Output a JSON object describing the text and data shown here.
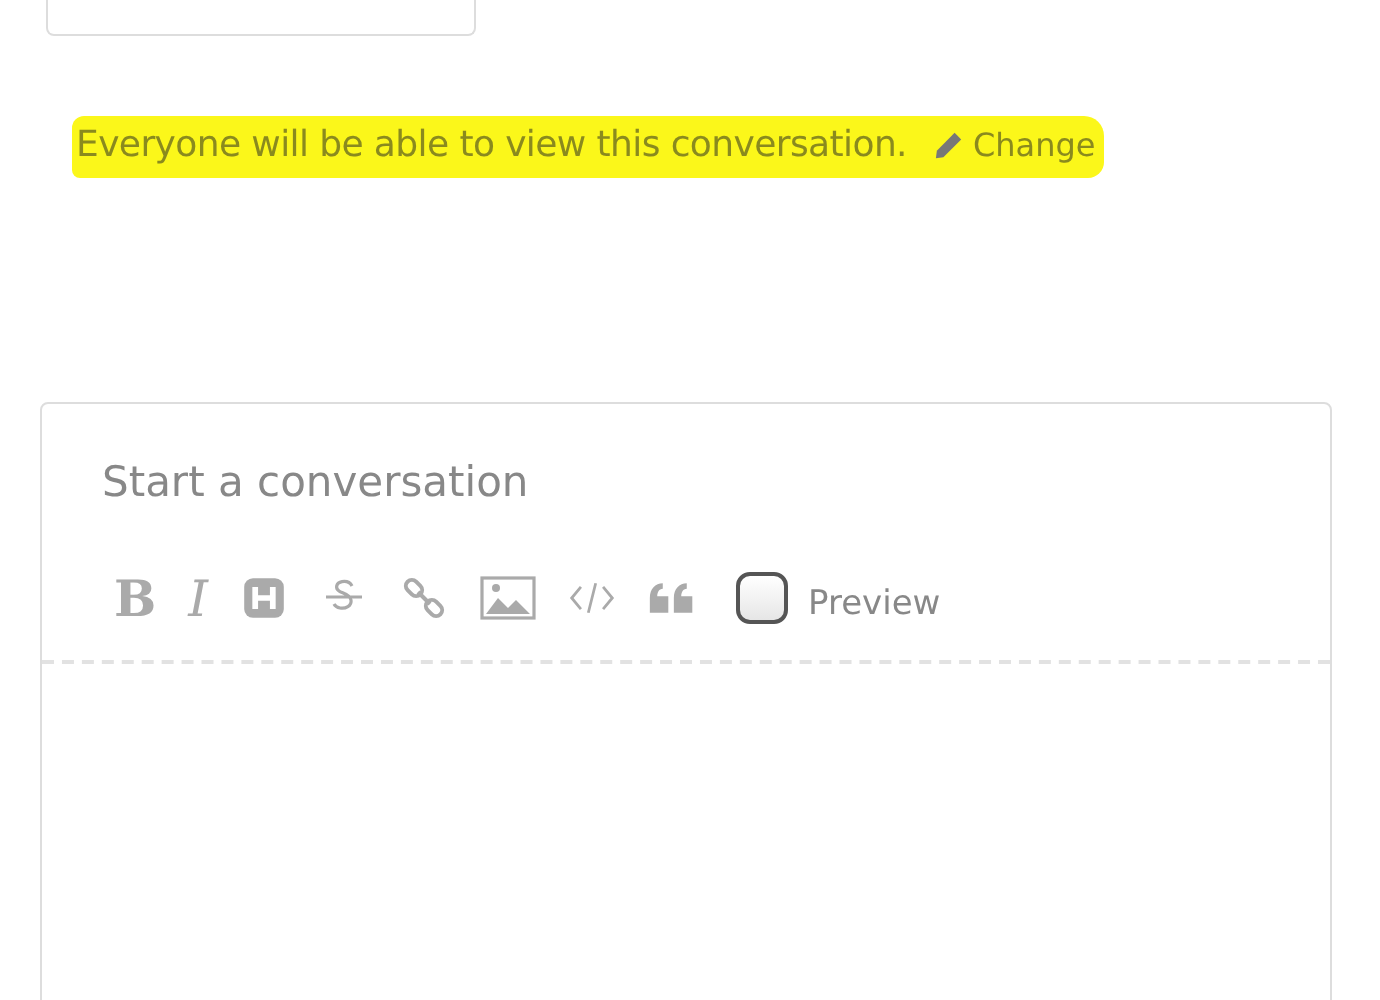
{
  "visibility_notice": {
    "text": "Everyone will be able to view this conversation.",
    "link": "Change",
    "highlighted": true
  },
  "editor": {
    "title_placeholder": "Start a conversation",
    "toolbar": [
      {
        "kind": "bold",
        "label": "B"
      },
      {
        "kind": "italic",
        "label": "I"
      },
      {
        "kind": "heading"
      },
      {
        "kind": "strikethrough"
      },
      {
        "kind": "link"
      },
      {
        "kind": "image"
      },
      {
        "kind": "code"
      },
      {
        "kind": "quote"
      }
    ],
    "preview": {
      "label": "Preview",
      "checked": false
    }
  }
}
